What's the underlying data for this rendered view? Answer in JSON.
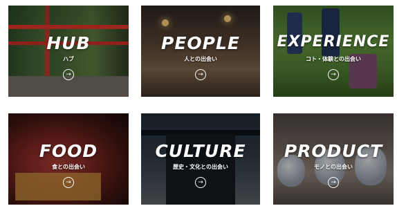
{
  "cards": [
    {
      "title": "HUB",
      "subtitle": "ハブ",
      "arrow": "→"
    },
    {
      "title": "PEOPLE",
      "subtitle": "人との出会い",
      "arrow": "→"
    },
    {
      "title": "EXPERIENCE",
      "subtitle": "コト・体験との出会い",
      "arrow": "→"
    },
    {
      "title": "FOOD",
      "subtitle": "食との出会い",
      "arrow": "→"
    },
    {
      "title": "CULTURE",
      "subtitle": "歴史・文化との出会い",
      "arrow": "→"
    },
    {
      "title": "PRODUCT",
      "subtitle": "モノとの出会い",
      "arrow": "→"
    }
  ],
  "colors": {
    "text": "#ffffff",
    "page_background": "#ffffff"
  }
}
